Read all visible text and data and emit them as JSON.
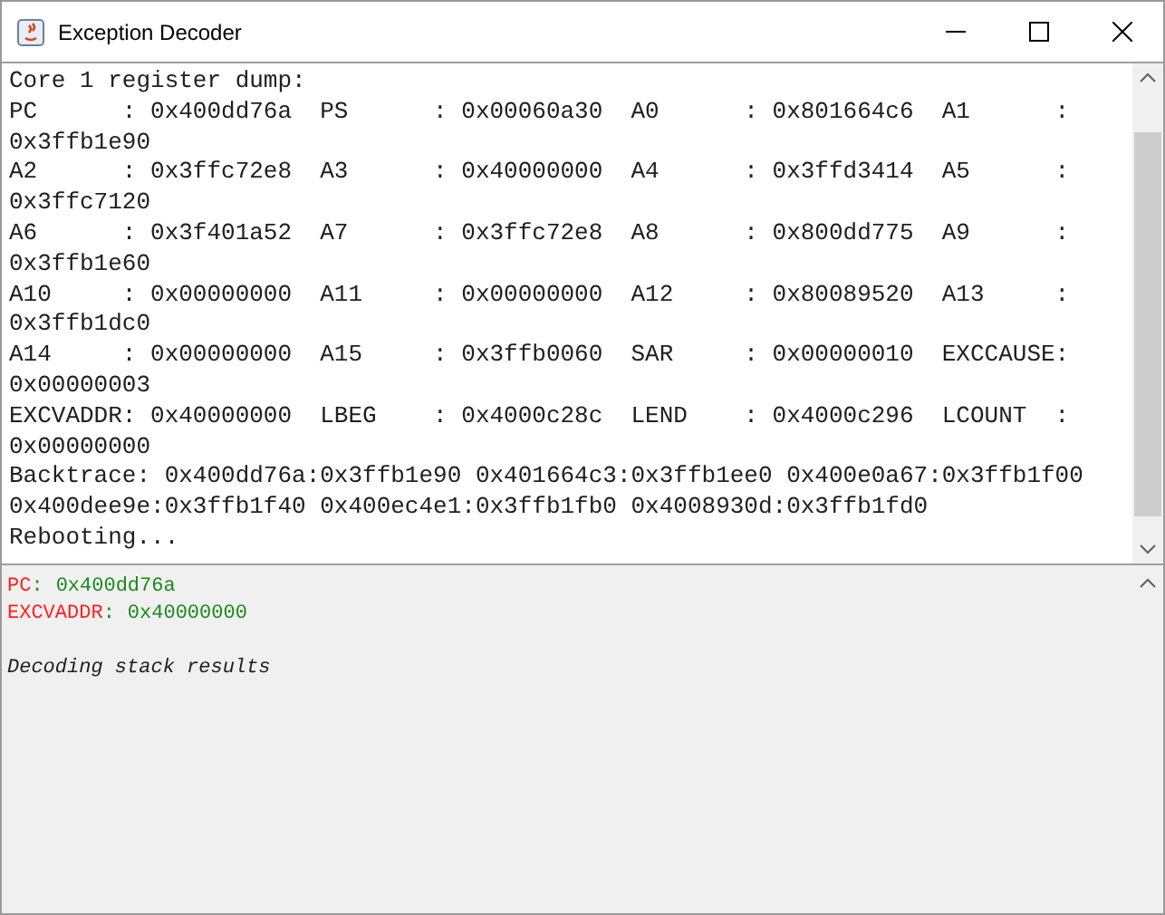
{
  "window": {
    "title": "Exception Decoder"
  },
  "dump": {
    "lines": [
      "Core 1 register dump:",
      "PC      : 0x400dd76a  PS      : 0x00060a30  A0      : 0x801664c6  A1      :",
      "0x3ffb1e90",
      "A2      : 0x3ffc72e8  A3      : 0x40000000  A4      : 0x3ffd3414  A5      :",
      "0x3ffc7120",
      "A6      : 0x3f401a52  A7      : 0x3ffc72e8  A8      : 0x800dd775  A9      :",
      "0x3ffb1e60",
      "A10     : 0x00000000  A11     : 0x00000000  A12     : 0x80089520  A13     :",
      "0x3ffb1dc0",
      "A14     : 0x00000000  A15     : 0x3ffb0060  SAR     : 0x00000010  EXCCAUSE:",
      "0x00000003",
      "EXCVADDR: 0x40000000  LBEG    : 0x4000c28c  LEND    : 0x4000c296  LCOUNT  :",
      "0x00000000",
      "Backtrace: 0x400dd76a:0x3ffb1e90 0x401664c3:0x3ffb1ee0 0x400e0a67:0x3ffb1f00",
      "0x400dee9e:0x3ffb1f40 0x400ec4e1:0x3ffb1fb0 0x4008930d:0x3ffb1fd0",
      "Rebooting..."
    ]
  },
  "results": [
    {
      "kind": "register",
      "label": "PC",
      "separator": ":",
      "value": "0x400dd76a"
    },
    {
      "kind": "register",
      "label": "EXCVADDR",
      "separator": ":",
      "value": "0x40000000"
    },
    {
      "kind": "heading",
      "text": "Decoding stack results"
    }
  ]
}
